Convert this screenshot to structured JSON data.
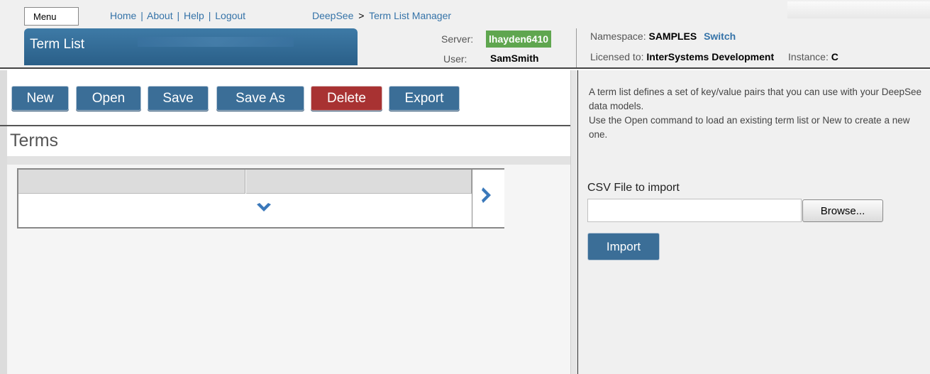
{
  "header": {
    "menu_label": "Menu",
    "links": [
      "Home",
      "About",
      "Help",
      "Logout"
    ],
    "link_separator": "|",
    "breadcrumb": {
      "root": "DeepSee",
      "arrow": ">",
      "current": "Term List Manager"
    },
    "page_title": "Term List",
    "server_label": "Server:",
    "server_value": "lhayden6410",
    "user_label": "User:",
    "user_value": "SamSmith",
    "namespace_label": "Namespace:",
    "namespace_value": "SAMPLES",
    "switch_label": "Switch",
    "licensed_label": "Licensed to:",
    "licensed_value": "InterSystems Development",
    "instance_label": "Instance:",
    "instance_value": "C"
  },
  "toolbar": {
    "new_label": "New",
    "open_label": "Open",
    "save_label": "Save",
    "save_as_label": "Save As",
    "delete_label": "Delete",
    "export_label": "Export"
  },
  "terms": {
    "title": "Terms"
  },
  "right_pane": {
    "help_line_1": "A term list defines a set of key/value pairs that you can use with your DeepSee data models.",
    "help_line_2": "Use the Open command to load an existing term list or New to create a new one.",
    "csv_label": "CSV File to import",
    "file_value": "",
    "browse_label": "Browse...",
    "import_label": "Import"
  },
  "colors": {
    "accent": "#3b6e97",
    "danger": "#a83232",
    "server_badge": "#5fa64f",
    "link": "#3573a8"
  },
  "icons": {
    "expand": "chevron-right-icon",
    "add_row": "chevron-down-icon"
  }
}
